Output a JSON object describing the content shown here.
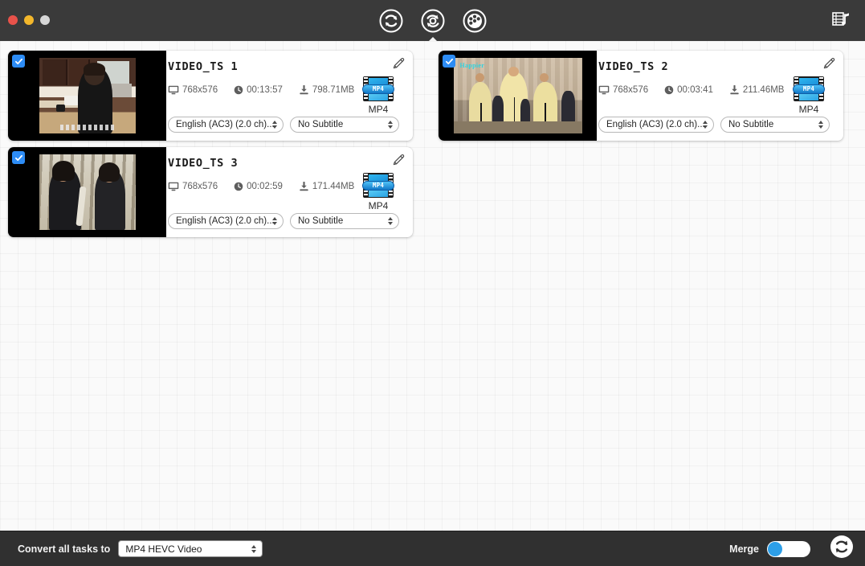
{
  "window": {
    "controls": [
      {
        "name": "close",
        "color": "#e8524a"
      },
      {
        "name": "minimize",
        "color": "#f3b72b"
      },
      {
        "name": "maximize",
        "color": "#d6d6d6"
      }
    ]
  },
  "toolbar": {
    "items": [
      {
        "icon": "convert-arrows-icon",
        "label": "Convert",
        "active": false
      },
      {
        "icon": "disc-ripper-icon",
        "label": "Ripper",
        "active": true
      },
      {
        "icon": "film-reel-download-icon",
        "label": "Downloader",
        "active": false
      }
    ],
    "right_icon": "media-toolbox-icon"
  },
  "cards": [
    {
      "checked": true,
      "title": "VIDEO_TS 1",
      "resolution": "768x576",
      "duration": "00:13:57",
      "size": "798.71MB",
      "format": "MP4",
      "format_badge": "MP4",
      "audio": "English (AC3) (2.0 ch)...",
      "subtitle": "No Subtitle",
      "thumb": "kitchen"
    },
    {
      "checked": true,
      "title": "VIDEO_TS 2",
      "resolution": "768x576",
      "duration": "00:03:41",
      "size": "211.46MB",
      "format": "MP4",
      "format_badge": "MP4",
      "audio": "English (AC3) (2.0 ch)...",
      "subtitle": "No Subtitle",
      "thumb": "stage",
      "watermark": "Happier"
    },
    {
      "checked": true,
      "title": "VIDEO_TS 3",
      "resolution": "768x576",
      "duration": "00:02:59",
      "size": "171.44MB",
      "format": "MP4",
      "format_badge": "MP4",
      "audio": "English (AC3) (2.0 ch)...",
      "subtitle": "No Subtitle",
      "thumb": "outdoor"
    }
  ],
  "bottom": {
    "convert_all_label": "Convert all tasks to",
    "output_format": "MP4 HEVC Video",
    "merge_label": "Merge",
    "merge_on": true,
    "convert_button_icon": "convert-circle-icon"
  },
  "colors": {
    "accent": "#2d8cf5",
    "toolbar_bg": "#3a3a3a",
    "bottombar_bg": "#303030",
    "toggle_knob": "#2d9fe8"
  }
}
